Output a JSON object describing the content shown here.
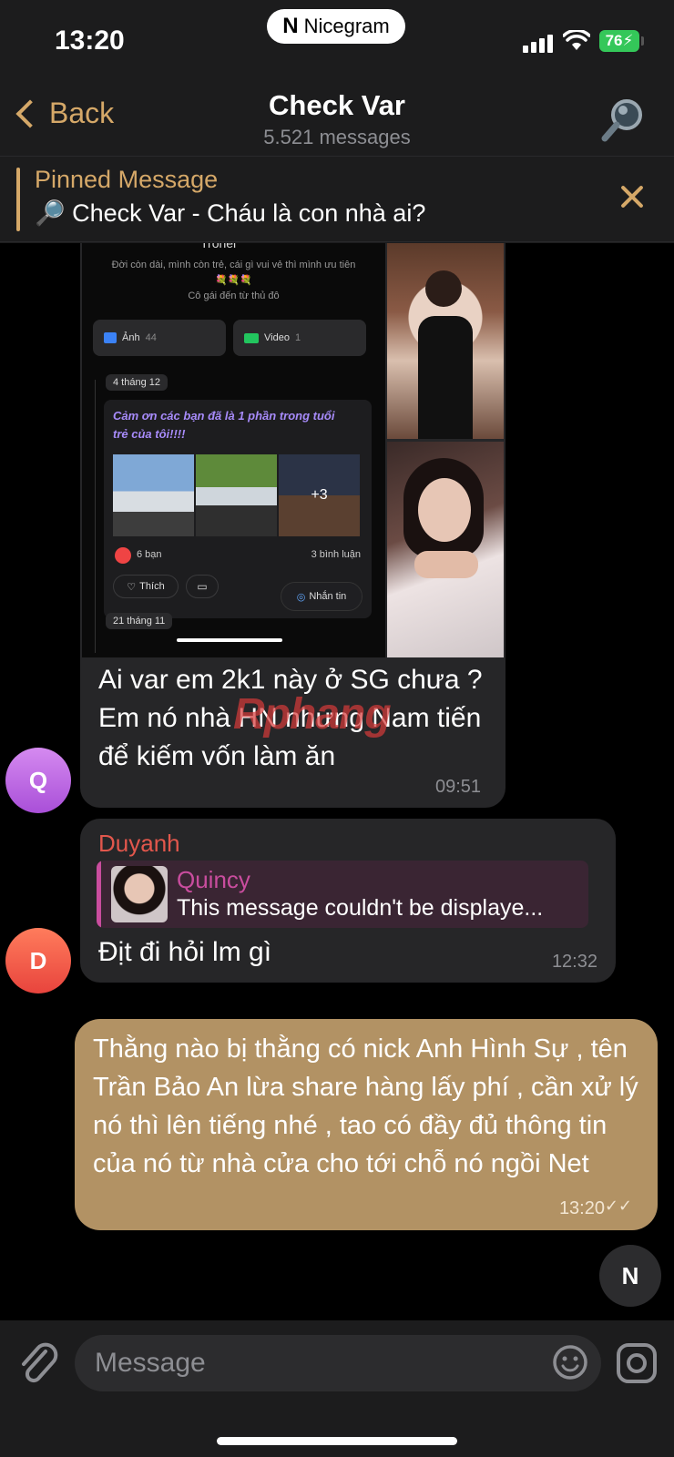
{
  "status": {
    "time": "13:20",
    "app_name": "Nicegram",
    "battery": "76"
  },
  "header": {
    "back_label": "Back",
    "title": "Check Var",
    "subtitle": "5.521 messages"
  },
  "pinned": {
    "label": "Pinned Message",
    "text": "🔎 Check Var - Cháu là con nhà ai?"
  },
  "screenshot": {
    "name": "Trohel",
    "bio_line1": "Đời còn dài, mình còn trẻ, cái gì vui vẻ thì mình ưu tiên",
    "bio_emoji": "💐💐💐",
    "bio_line2": "Cô gái đến từ thủ đô",
    "photos_label": "Ảnh",
    "photos_count": "44",
    "video_label": "Video",
    "video_count": "1",
    "date1": "4 tháng 12",
    "post_caption": "Cảm ơn các bạn đã là 1 phần trong tuổi trẻ của tôi!!!!",
    "more_count": "+3",
    "likes": "6 bạn",
    "comments": "3 bình luận",
    "like_btn": "Thích",
    "message_btn": "Nhắn tin",
    "date2": "21 tháng 11"
  },
  "messages": [
    {
      "avatar_letter": "Q",
      "text": "Ai var em 2k1 này ở SG chưa ? Em nó nhà HN nhưng Nam tiến để kiếm vốn làm ăn",
      "time": "09:51",
      "watermark": "Rphang"
    },
    {
      "avatar_letter": "D",
      "sender": "Duyanh",
      "reply_name": "Quincy",
      "reply_text": "This message couldn't be displaye...",
      "text": "Địt đi hỏi lm gì",
      "time": "12:32"
    },
    {
      "text": "Thằng nào bị thằng có nick Anh Hình Sự , tên Trần Bảo An lừa share hàng lấy phí , cần xử lý nó thì lên tiếng nhé , tao có đầy đủ thông tin của nó từ nhà cửa cho tới chỗ nó ngồi Net",
      "time": "13:20"
    }
  ],
  "input": {
    "placeholder": "Message"
  },
  "colors": {
    "accent": "#d5a868",
    "outgoing": "#b29264",
    "incoming": "#262628",
    "sender_name": "#e2574c",
    "reply_name": "#c94d9e",
    "avatar_q": "#c56ae6",
    "avatar_d": "#ef5a4d"
  }
}
